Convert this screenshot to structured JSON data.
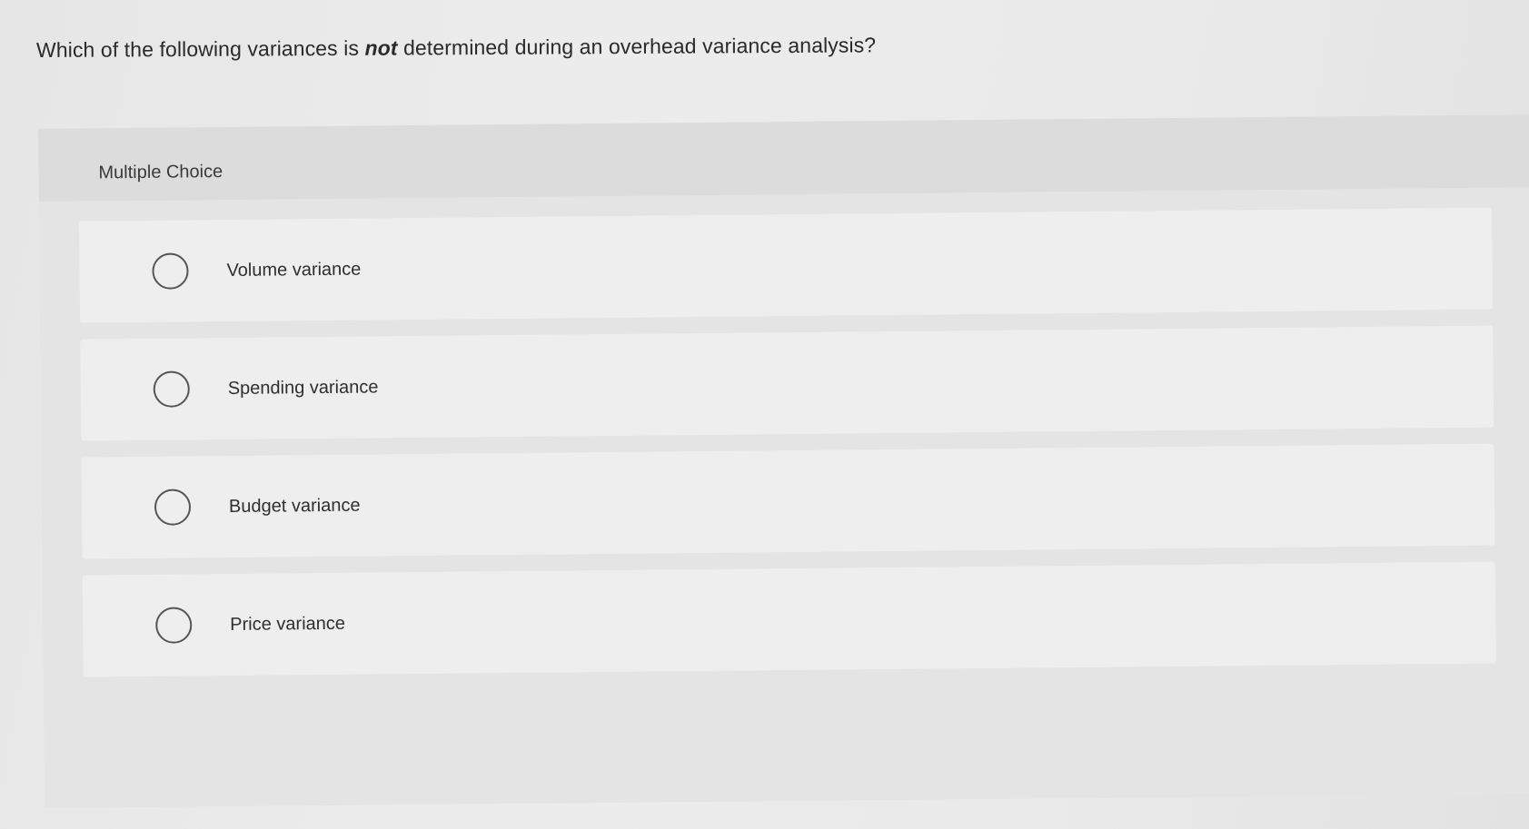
{
  "question": {
    "prefix": "Which of the following variances is ",
    "emphasis": "not",
    "suffix": " determined during an overhead variance analysis?"
  },
  "panel": {
    "label": "Multiple Choice"
  },
  "options": [
    {
      "label": "Volume variance"
    },
    {
      "label": "Spending variance"
    },
    {
      "label": "Budget variance"
    },
    {
      "label": "Price variance"
    }
  ]
}
